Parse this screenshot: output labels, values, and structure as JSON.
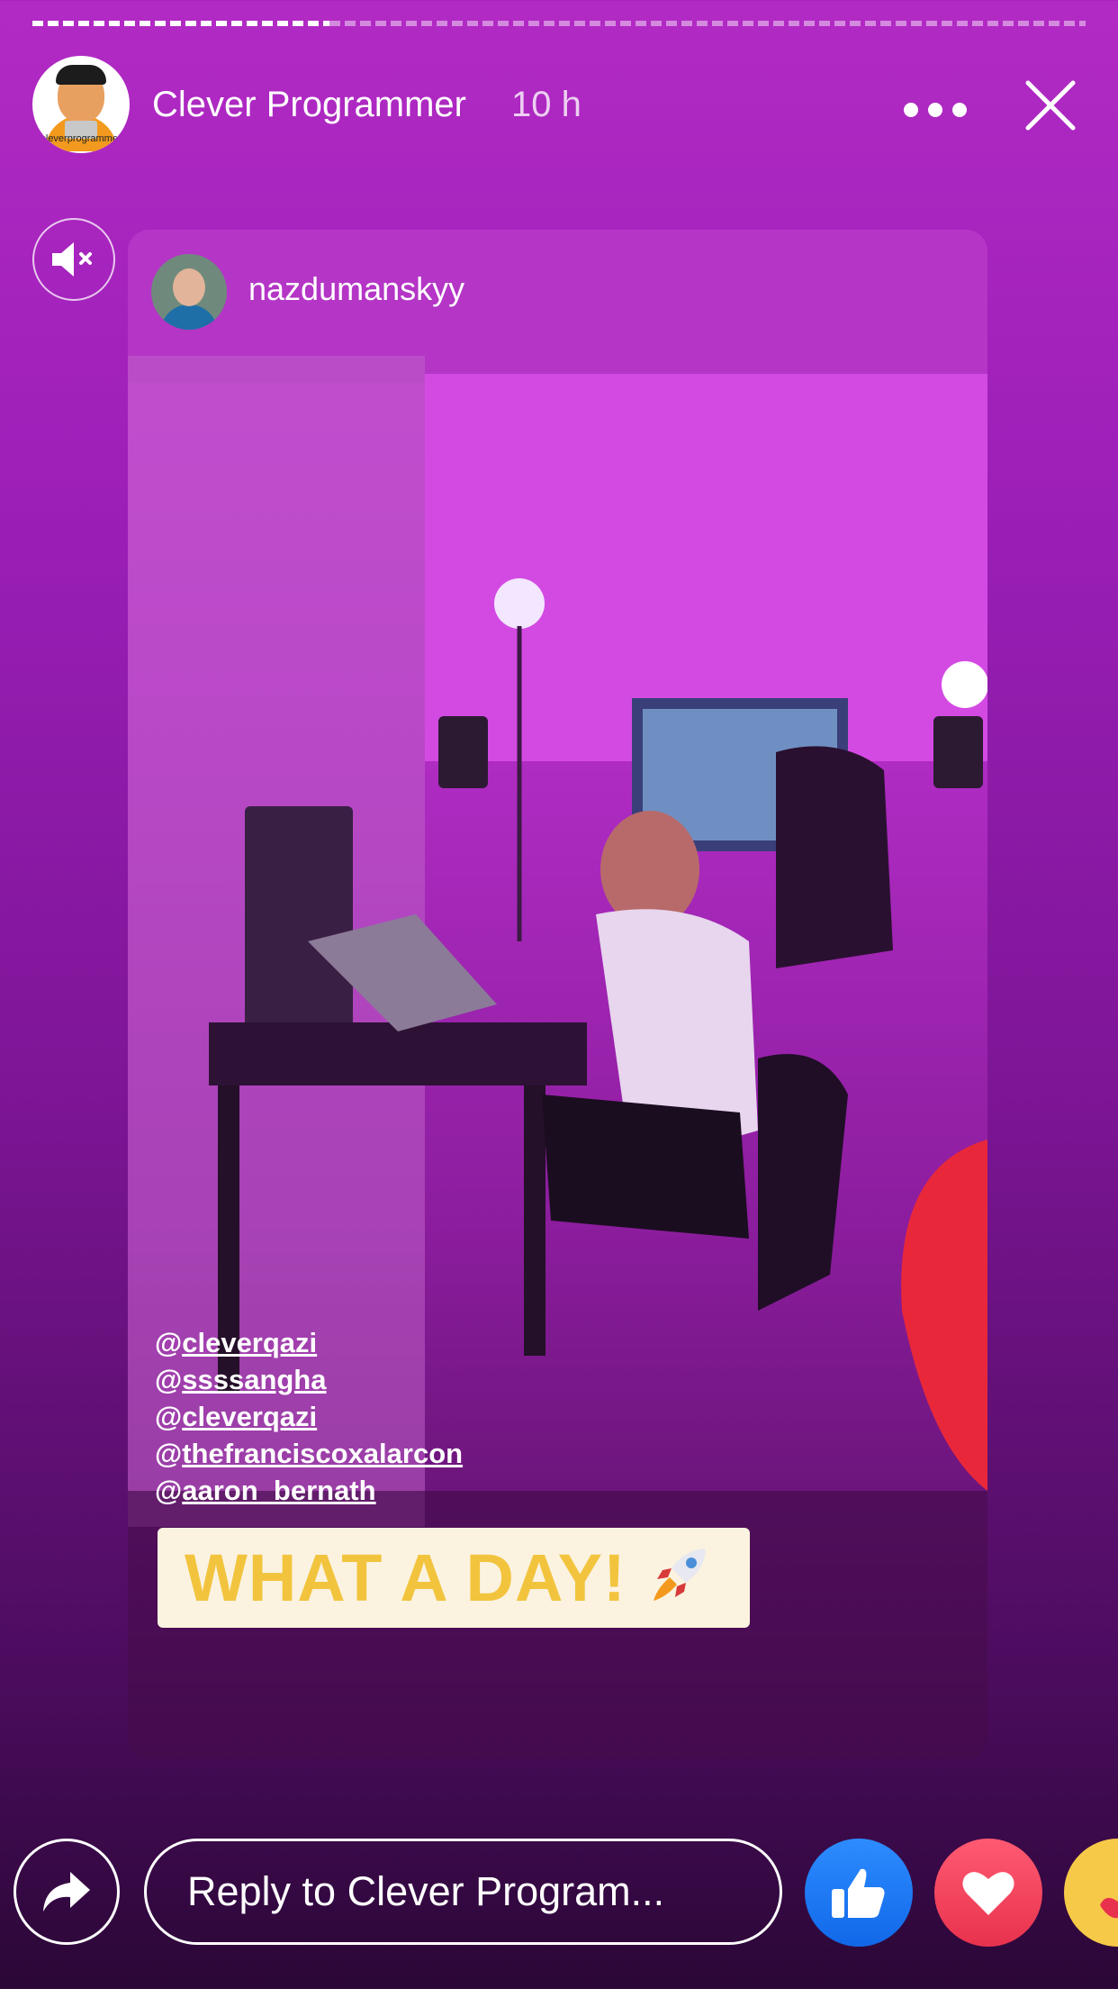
{
  "header": {
    "channel_name": "Clever Programmer",
    "time_ago": "10 h",
    "avatar_brand": "cleverprogrammer"
  },
  "progress": {
    "segments": 2,
    "current": 1,
    "fraction_viewed": 0.2
  },
  "story": {
    "username": "nazdumanskyy",
    "mentions": [
      "cleverqazi",
      "ssssangha",
      "cleverqazi",
      "thefranciscoxalarcon",
      "aaron_bernath"
    ],
    "banner_text": "WHAT A DAY!"
  },
  "footer": {
    "reply_placeholder": "Reply to Clever Program..."
  },
  "colors": {
    "background_top": "#b22ac4",
    "background_bottom": "#2a0736",
    "like_blue": "#1877f2",
    "love_red": "#f33e58",
    "banner_text": "#f2c43e"
  },
  "icons": [
    "close-icon",
    "more-icon",
    "mute-icon",
    "share-icon",
    "like-icon",
    "love-icon",
    "care-icon",
    "rocket-icon"
  ]
}
